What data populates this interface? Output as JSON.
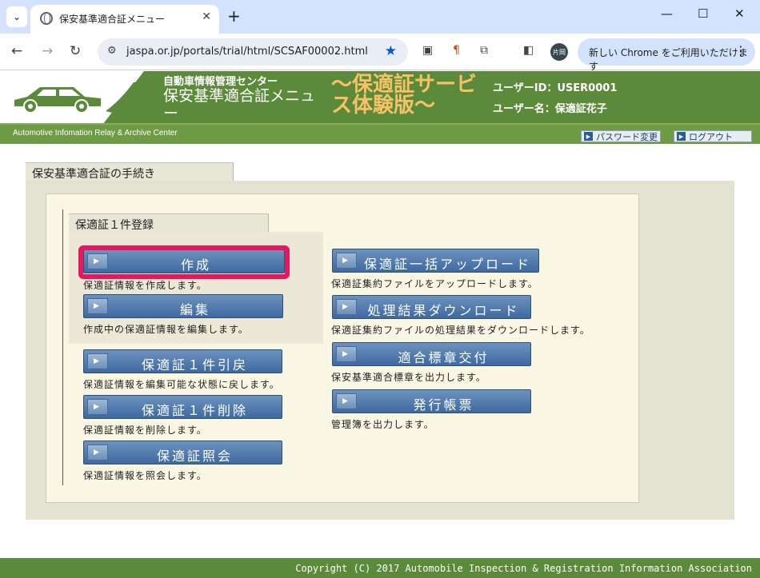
{
  "browser": {
    "tab_title": "保安基準適合証メニュー",
    "url": "jaspa.or.jp/portals/trial/html/SCSAF00002.html",
    "profile_label": "片岡",
    "update_text": "新しい Chrome をご利用いただけます",
    "icons": [
      "tab-list-icon",
      "globe-icon",
      "close-icon",
      "plus-icon",
      "minimize-icon",
      "maximize-icon",
      "window-close-icon",
      "back-arrow-icon",
      "forward-arrow-icon",
      "reload-icon",
      "tune-icon",
      "star-icon",
      "cast-icon",
      "paragraph-icon",
      "extension-icon",
      "sidepanel-icon",
      "kebab-menu-icon"
    ]
  },
  "header": {
    "org_name": "自動車情報管理センター",
    "menu_title": "保安基準適合証メニュー",
    "trial_label": "〜保適証サービス体験版〜",
    "user_id": "ユーザーID：USER0001",
    "user_name": "ユーザー名：保適証花子",
    "org_name_en": "Automotive Infomation Relay & Archive Center",
    "password_link": "パスワード変更",
    "logout_link": "ログアウト"
  },
  "section": {
    "title": "保安基準適合証の手続き",
    "group_title": "保適証１件登録"
  },
  "buttons": {
    "create": {
      "label": "作成",
      "desc": "保適証情報を作成します。"
    },
    "edit": {
      "label": "編集",
      "desc": "作成中の保適証情報を編集します。"
    },
    "revert": {
      "label": "保適証１件引戻",
      "desc": "保適証情報を編集可能な状態に戻します。"
    },
    "delete": {
      "label": "保適証１件削除",
      "desc": "保適証情報を削除します。"
    },
    "inquiry": {
      "label": "保適証照会",
      "desc": "保適証情報を照会します。"
    },
    "bulk_upload": {
      "label": "保適証一括アップロード",
      "desc": "保適証集約ファイルをアップロードします。"
    },
    "result_download": {
      "label": "処理結果ダウンロード",
      "desc": "保適証集約ファイルの処理結果をダウンロードします。"
    },
    "seal_issue": {
      "label": "適合標章交付",
      "desc": "保安基準適合標章を出力します。"
    },
    "ledger": {
      "label": "発行帳票",
      "desc": "管理簿を出力します。"
    }
  },
  "footer": {
    "copyright": "Copyright (C) 2017 Automobile Inspection & Registration Information Association"
  },
  "colors": {
    "header_green": "#5c8a3b",
    "button_blue": "#3e6aa0",
    "highlight_pink": "#e8175d",
    "trial_orange": "#f5c266"
  }
}
